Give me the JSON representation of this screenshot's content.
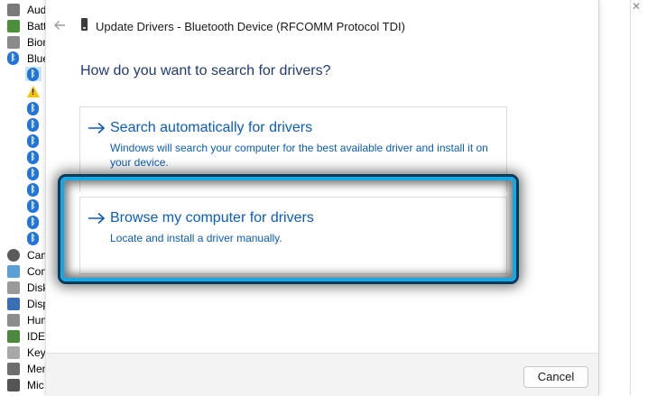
{
  "window": {
    "title": "Update Drivers - Bluetooth Device (RFCOMM Protocol TDI)"
  },
  "heading": "How do you want to search for drivers?",
  "options": [
    {
      "title": "Search automatically for drivers",
      "description": "Windows will search your computer for the best available driver and install it on your device."
    },
    {
      "title": "Browse my computer for drivers",
      "description": "Locate and install a driver manually."
    }
  ],
  "footer": {
    "cancel_label": "Cancel"
  },
  "background_tree": {
    "items": [
      {
        "label": "Aud",
        "icon": "audio-icon"
      },
      {
        "label": "Batt",
        "icon": "battery-icon"
      },
      {
        "label": "Biom",
        "icon": "biometric-icon"
      },
      {
        "label": "Blue",
        "icon": "bluetooth-icon"
      },
      {
        "label": "Cam",
        "icon": "camera-icon"
      },
      {
        "label": "Con",
        "icon": "computer-icon"
      },
      {
        "label": "Disk",
        "icon": "disk-icon"
      },
      {
        "label": "Disp",
        "icon": "display-icon"
      },
      {
        "label": "Hum",
        "icon": "hid-icon"
      },
      {
        "label": "IDE",
        "icon": "ide-icon"
      },
      {
        "label": "Keyb",
        "icon": "keyboard-icon"
      },
      {
        "label": "Men",
        "icon": "memory-icon"
      },
      {
        "label": "Mic",
        "icon": "microphone-icon"
      }
    ]
  },
  "colors": {
    "accent": "#0a5bc7",
    "highlight": "#17a7e3",
    "bluetooth": "#1f74e0"
  }
}
